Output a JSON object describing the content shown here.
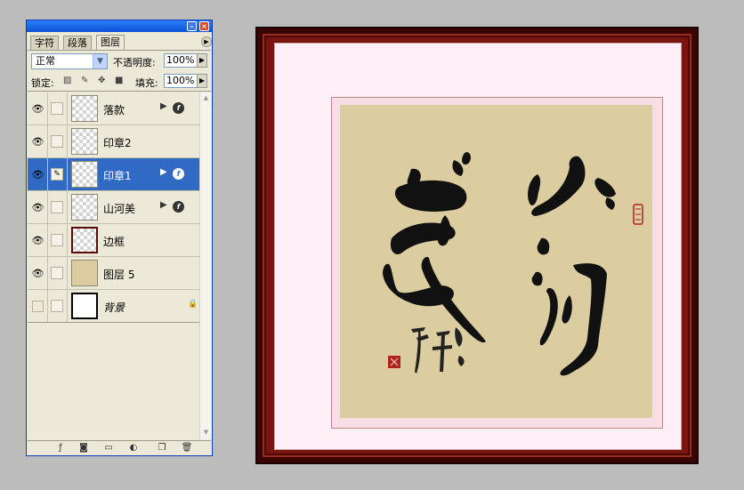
{
  "palette": {
    "tabs": [
      {
        "label": "字符",
        "active": false
      },
      {
        "label": "段落",
        "active": false
      },
      {
        "label": "图层",
        "active": true
      }
    ],
    "blend_mode": "正常",
    "opacity_label": "不透明度:",
    "opacity_value": "100%",
    "lock_label": "锁定:",
    "fill_label": "填充:",
    "fill_value": "100%",
    "layers": [
      {
        "name": "落款",
        "visible": true,
        "has_fx": true,
        "selected": false
      },
      {
        "name": "印章2",
        "visible": true,
        "has_fx": false,
        "selected": false
      },
      {
        "name": "印章1",
        "visible": true,
        "has_fx": true,
        "selected": true
      },
      {
        "name": "山河美",
        "visible": true,
        "has_fx": true,
        "selected": false
      },
      {
        "name": "边框",
        "visible": true,
        "has_fx": false,
        "selected": false
      },
      {
        "name": "图层 5",
        "visible": true,
        "has_fx": false,
        "selected": false
      },
      {
        "name": "背景",
        "visible": false,
        "has_fx": false,
        "selected": false,
        "locked": true
      }
    ]
  },
  "colors": {
    "selection": "#316ac5",
    "panel_bg": "#ece9d8",
    "frame": "#7a1410",
    "mat": "#fff0f7",
    "paper": "#dccda0",
    "seal": "#b0201c"
  }
}
